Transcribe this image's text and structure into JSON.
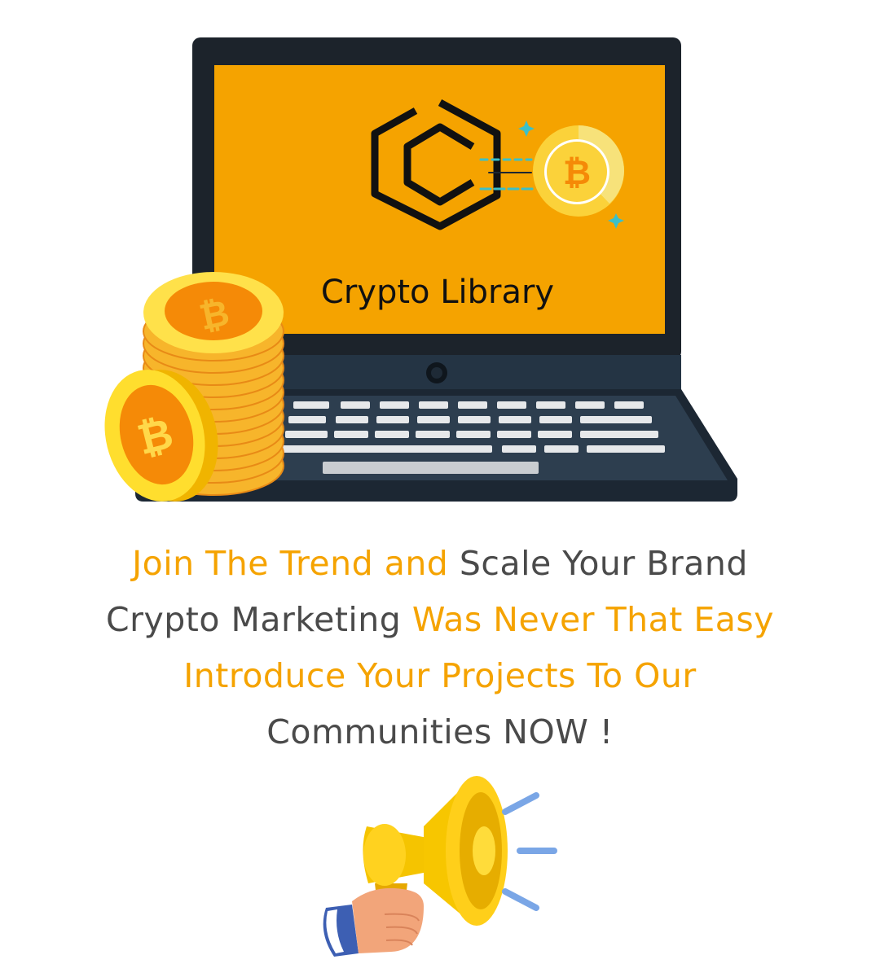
{
  "brand": {
    "name": "Crypto Library",
    "accent_color": "#f5a300",
    "dark_color": "#1c2733"
  },
  "headline": {
    "line1": {
      "highlight": "Join The Trend and",
      "plain": "Scale Your Brand"
    },
    "line2": {
      "plain": "Crypto Marketing",
      "highlight": "Was Never That Easy"
    },
    "line3": {
      "highlight": "Introduce Your Projects To Our"
    },
    "line4": {
      "plain": "Communities NOW !"
    }
  },
  "icons": {
    "coin_symbol": "₿",
    "illustrations": [
      "laptop-icon",
      "bitcoin-coin-stack-icon",
      "crypto-library-logo-icon",
      "megaphone-icon",
      "hand-icon"
    ]
  }
}
